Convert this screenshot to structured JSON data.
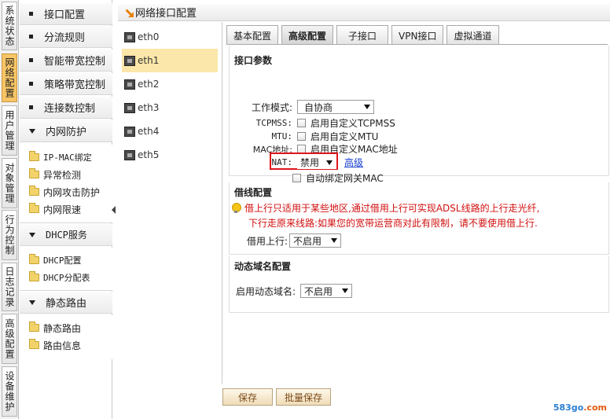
{
  "categories": [
    {
      "label": "系统状态",
      "active": false
    },
    {
      "label": "网络配置",
      "active": true
    },
    {
      "label": "用户管理",
      "active": false
    },
    {
      "label": "对象管理",
      "active": false
    },
    {
      "label": "行为控制",
      "active": false
    },
    {
      "label": "日志记录",
      "active": false
    },
    {
      "label": "高级配置",
      "active": false
    },
    {
      "label": "设备维护",
      "active": false
    }
  ],
  "menu": {
    "item_interface": "接口配置",
    "item_shunt": "分流规则",
    "item_smart_bw": "智能带宽控制",
    "item_policy_bw": "策略带宽控制",
    "item_conn": "连接数控制",
    "group_intranet": "内网防护",
    "sub_ipmac": "IP-MAC绑定",
    "sub_anomaly": "异常检测",
    "sub_attack": "内网攻击防护",
    "sub_limit": "内网限速",
    "group_dhcp": "DHCP服务",
    "sub_dhcp_config": "DHCP配置",
    "sub_dhcp_table": "DHCP分配表",
    "group_route": "静态路由",
    "sub_static_route": "静态路由",
    "sub_route_info": "路由信息"
  },
  "main": {
    "title": "网络接口配置",
    "interfaces": [
      "eth0",
      "eth1",
      "eth2",
      "eth3",
      "eth4",
      "eth5"
    ],
    "selected_interface": "eth1",
    "tabs": [
      "基本配置",
      "高级配置",
      "子接口",
      "VPN接口",
      "虚拟通道"
    ],
    "active_tab": "高级配置"
  },
  "iface_params": {
    "title": "接口参数",
    "work_mode_label": "工作模式:",
    "work_mode_value": "自协商",
    "tcpmss_label": "TCPMSS:",
    "tcpmss_check": "启用自定义TCPMSS",
    "mtu_label": "MTU:",
    "mtu_check": "启用自定义MTU",
    "mac_label": "MAC地址:",
    "mac_check": "启用自定义MAC地址",
    "nat_label": "NAT:",
    "nat_value": "禁用",
    "advanced_link": "高级",
    "auto_bind_check": "自动绑定网关MAC"
  },
  "borrow": {
    "title": "借线配置",
    "tip_line1": "借上行只适用于某些地区,通过借用上行可实现ADSL线路的上行走光纤,",
    "tip_line2": "下行走原来线路:如果您的宽带运营商对此有限制，请不要使用借上行.",
    "borrow_label": "借用上行:",
    "borrow_value": "不启用"
  },
  "ddns": {
    "title": "动态域名配置",
    "enable_label": "启用动态域名:",
    "enable_value": "不启用"
  },
  "buttons": {
    "save": "保存",
    "batch_save": "批量保存"
  },
  "watermark": {
    "prefix": "583go",
    "suffix": ".com"
  },
  "colors": {
    "active_category": "#f7c565",
    "selected_interface": "#fbe7a9",
    "highlight_box": "#e0141b",
    "warning_text": "#d10f0f",
    "link": "#1a3fd0"
  }
}
